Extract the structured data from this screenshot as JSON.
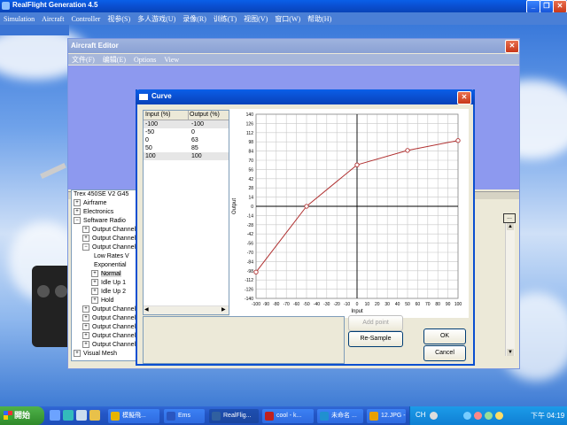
{
  "app": {
    "title": "RealFlight Generation 4.5",
    "menu": [
      "Simulation",
      "Aircraft",
      "Controller",
      "视参(S)",
      "多人游戏(U)",
      "录像(R)",
      "训练(T)",
      "视图(V)",
      "窗口(W)",
      "帮助(H)"
    ]
  },
  "aircraft_editor": {
    "title": "Aircraft Editor",
    "menu": [
      "文件(F)",
      "编辑(E)",
      "Options",
      "View"
    ],
    "tree_root": "Trex 450SE V2 G45",
    "tree": [
      {
        "label": "Airframe",
        "indent": 1,
        "box": "+"
      },
      {
        "label": "Electronics",
        "indent": 1,
        "box": "+"
      },
      {
        "label": "Software Radio",
        "indent": 1,
        "box": "-"
      },
      {
        "label": "Output Channel",
        "indent": 2,
        "box": "+"
      },
      {
        "label": "Output Channel",
        "indent": 2,
        "box": "+"
      },
      {
        "label": "Output Channel",
        "indent": 2,
        "box": "-"
      },
      {
        "label": "Low Rates V",
        "indent": 3,
        "box": ""
      },
      {
        "label": "Exponential",
        "indent": 3,
        "box": ""
      },
      {
        "label": "Normal",
        "indent": 3,
        "box": "+",
        "selected": true
      },
      {
        "label": "Idle Up 1",
        "indent": 3,
        "box": "+"
      },
      {
        "label": "Idle Up 2",
        "indent": 3,
        "box": "+"
      },
      {
        "label": "Hold",
        "indent": 3,
        "box": "+"
      },
      {
        "label": "Output Channel",
        "indent": 2,
        "box": "+"
      },
      {
        "label": "Output Channel",
        "indent": 2,
        "box": "+"
      },
      {
        "label": "Output Channel",
        "indent": 2,
        "box": "+"
      },
      {
        "label": "Output Channel",
        "indent": 2,
        "box": "+"
      },
      {
        "label": "Output Channel",
        "indent": 2,
        "box": "+"
      },
      {
        "label": "Visual Mesh",
        "indent": 1,
        "box": "+"
      }
    ],
    "ellipsis_label": "..."
  },
  "curve_dialog": {
    "title": "Curve",
    "columns": [
      "Input (%)",
      "Output (%)"
    ],
    "rows": [
      [
        "-100",
        "-100"
      ],
      [
        "-50",
        "0"
      ],
      [
        "0",
        "63"
      ],
      [
        "50",
        "85"
      ],
      [
        "100",
        "100"
      ]
    ],
    "add_point": "Add point",
    "resample": "Re-Sample",
    "ok": "OK",
    "cancel": "Cancel"
  },
  "chart_data": {
    "type": "line",
    "x": [
      -100,
      -50,
      0,
      50,
      100
    ],
    "y": [
      -100,
      0,
      63,
      85,
      100
    ],
    "xlabel": "Input",
    "ylabel": "Output",
    "xlim": [
      -100,
      100
    ],
    "ylim": [
      -140,
      140
    ],
    "xticks": [
      -100,
      -90,
      -80,
      -70,
      -60,
      -50,
      -40,
      -30,
      -20,
      -10,
      0,
      10,
      20,
      30,
      40,
      50,
      60,
      70,
      80,
      90,
      100
    ],
    "yticks": [
      140,
      126,
      112,
      98,
      84,
      70,
      56,
      42,
      28,
      14,
      0,
      -14,
      -28,
      -42,
      -56,
      -70,
      -84,
      -98,
      -112,
      -126,
      -140
    ],
    "grid": true,
    "color": "#b03030"
  },
  "taskbar": {
    "start": "開始",
    "tasks": [
      {
        "label": "模擬飛...",
        "color": "#e7b400"
      },
      {
        "label": "Ems",
        "color": "#2a56c0"
      },
      {
        "label": "RealFlig...",
        "color": "#3060a0"
      },
      {
        "label": "cool - k...",
        "color": "#c02020"
      },
      {
        "label": "未命名 ...",
        "color": "#2090d0"
      },
      {
        "label": "12.JPG - ...",
        "color": "#e8a000"
      }
    ],
    "lang": "CH",
    "clock": "下午 04:19"
  }
}
